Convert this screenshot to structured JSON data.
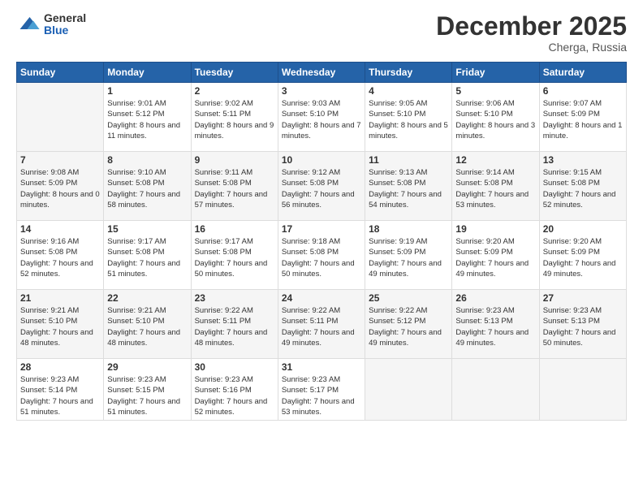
{
  "logo": {
    "general": "General",
    "blue": "Blue"
  },
  "header": {
    "month": "December 2025",
    "location": "Cherga, Russia"
  },
  "weekdays": [
    "Sunday",
    "Monday",
    "Tuesday",
    "Wednesday",
    "Thursday",
    "Friday",
    "Saturday"
  ],
  "weeks": [
    [
      {
        "day": "",
        "sunrise": "",
        "sunset": "",
        "daylight": ""
      },
      {
        "day": "1",
        "sunrise": "Sunrise: 9:01 AM",
        "sunset": "Sunset: 5:12 PM",
        "daylight": "Daylight: 8 hours and 11 minutes."
      },
      {
        "day": "2",
        "sunrise": "Sunrise: 9:02 AM",
        "sunset": "Sunset: 5:11 PM",
        "daylight": "Daylight: 8 hours and 9 minutes."
      },
      {
        "day": "3",
        "sunrise": "Sunrise: 9:03 AM",
        "sunset": "Sunset: 5:10 PM",
        "daylight": "Daylight: 8 hours and 7 minutes."
      },
      {
        "day": "4",
        "sunrise": "Sunrise: 9:05 AM",
        "sunset": "Sunset: 5:10 PM",
        "daylight": "Daylight: 8 hours and 5 minutes."
      },
      {
        "day": "5",
        "sunrise": "Sunrise: 9:06 AM",
        "sunset": "Sunset: 5:10 PM",
        "daylight": "Daylight: 8 hours and 3 minutes."
      },
      {
        "day": "6",
        "sunrise": "Sunrise: 9:07 AM",
        "sunset": "Sunset: 5:09 PM",
        "daylight": "Daylight: 8 hours and 1 minute."
      }
    ],
    [
      {
        "day": "7",
        "sunrise": "Sunrise: 9:08 AM",
        "sunset": "Sunset: 5:09 PM",
        "daylight": "Daylight: 8 hours and 0 minutes."
      },
      {
        "day": "8",
        "sunrise": "Sunrise: 9:10 AM",
        "sunset": "Sunset: 5:08 PM",
        "daylight": "Daylight: 7 hours and 58 minutes."
      },
      {
        "day": "9",
        "sunrise": "Sunrise: 9:11 AM",
        "sunset": "Sunset: 5:08 PM",
        "daylight": "Daylight: 7 hours and 57 minutes."
      },
      {
        "day": "10",
        "sunrise": "Sunrise: 9:12 AM",
        "sunset": "Sunset: 5:08 PM",
        "daylight": "Daylight: 7 hours and 56 minutes."
      },
      {
        "day": "11",
        "sunrise": "Sunrise: 9:13 AM",
        "sunset": "Sunset: 5:08 PM",
        "daylight": "Daylight: 7 hours and 54 minutes."
      },
      {
        "day": "12",
        "sunrise": "Sunrise: 9:14 AM",
        "sunset": "Sunset: 5:08 PM",
        "daylight": "Daylight: 7 hours and 53 minutes."
      },
      {
        "day": "13",
        "sunrise": "Sunrise: 9:15 AM",
        "sunset": "Sunset: 5:08 PM",
        "daylight": "Daylight: 7 hours and 52 minutes."
      }
    ],
    [
      {
        "day": "14",
        "sunrise": "Sunrise: 9:16 AM",
        "sunset": "Sunset: 5:08 PM",
        "daylight": "Daylight: 7 hours and 52 minutes."
      },
      {
        "day": "15",
        "sunrise": "Sunrise: 9:17 AM",
        "sunset": "Sunset: 5:08 PM",
        "daylight": "Daylight: 7 hours and 51 minutes."
      },
      {
        "day": "16",
        "sunrise": "Sunrise: 9:17 AM",
        "sunset": "Sunset: 5:08 PM",
        "daylight": "Daylight: 7 hours and 50 minutes."
      },
      {
        "day": "17",
        "sunrise": "Sunrise: 9:18 AM",
        "sunset": "Sunset: 5:08 PM",
        "daylight": "Daylight: 7 hours and 50 minutes."
      },
      {
        "day": "18",
        "sunrise": "Sunrise: 9:19 AM",
        "sunset": "Sunset: 5:09 PM",
        "daylight": "Daylight: 7 hours and 49 minutes."
      },
      {
        "day": "19",
        "sunrise": "Sunrise: 9:20 AM",
        "sunset": "Sunset: 5:09 PM",
        "daylight": "Daylight: 7 hours and 49 minutes."
      },
      {
        "day": "20",
        "sunrise": "Sunrise: 9:20 AM",
        "sunset": "Sunset: 5:09 PM",
        "daylight": "Daylight: 7 hours and 49 minutes."
      }
    ],
    [
      {
        "day": "21",
        "sunrise": "Sunrise: 9:21 AM",
        "sunset": "Sunset: 5:10 PM",
        "daylight": "Daylight: 7 hours and 48 minutes."
      },
      {
        "day": "22",
        "sunrise": "Sunrise: 9:21 AM",
        "sunset": "Sunset: 5:10 PM",
        "daylight": "Daylight: 7 hours and 48 minutes."
      },
      {
        "day": "23",
        "sunrise": "Sunrise: 9:22 AM",
        "sunset": "Sunset: 5:11 PM",
        "daylight": "Daylight: 7 hours and 48 minutes."
      },
      {
        "day": "24",
        "sunrise": "Sunrise: 9:22 AM",
        "sunset": "Sunset: 5:11 PM",
        "daylight": "Daylight: 7 hours and 49 minutes."
      },
      {
        "day": "25",
        "sunrise": "Sunrise: 9:22 AM",
        "sunset": "Sunset: 5:12 PM",
        "daylight": "Daylight: 7 hours and 49 minutes."
      },
      {
        "day": "26",
        "sunrise": "Sunrise: 9:23 AM",
        "sunset": "Sunset: 5:13 PM",
        "daylight": "Daylight: 7 hours and 49 minutes."
      },
      {
        "day": "27",
        "sunrise": "Sunrise: 9:23 AM",
        "sunset": "Sunset: 5:13 PM",
        "daylight": "Daylight: 7 hours and 50 minutes."
      }
    ],
    [
      {
        "day": "28",
        "sunrise": "Sunrise: 9:23 AM",
        "sunset": "Sunset: 5:14 PM",
        "daylight": "Daylight: 7 hours and 51 minutes."
      },
      {
        "day": "29",
        "sunrise": "Sunrise: 9:23 AM",
        "sunset": "Sunset: 5:15 PM",
        "daylight": "Daylight: 7 hours and 51 minutes."
      },
      {
        "day": "30",
        "sunrise": "Sunrise: 9:23 AM",
        "sunset": "Sunset: 5:16 PM",
        "daylight": "Daylight: 7 hours and 52 minutes."
      },
      {
        "day": "31",
        "sunrise": "Sunrise: 9:23 AM",
        "sunset": "Sunset: 5:17 PM",
        "daylight": "Daylight: 7 hours and 53 minutes."
      },
      {
        "day": "",
        "sunrise": "",
        "sunset": "",
        "daylight": ""
      },
      {
        "day": "",
        "sunrise": "",
        "sunset": "",
        "daylight": ""
      },
      {
        "day": "",
        "sunrise": "",
        "sunset": "",
        "daylight": ""
      }
    ]
  ]
}
